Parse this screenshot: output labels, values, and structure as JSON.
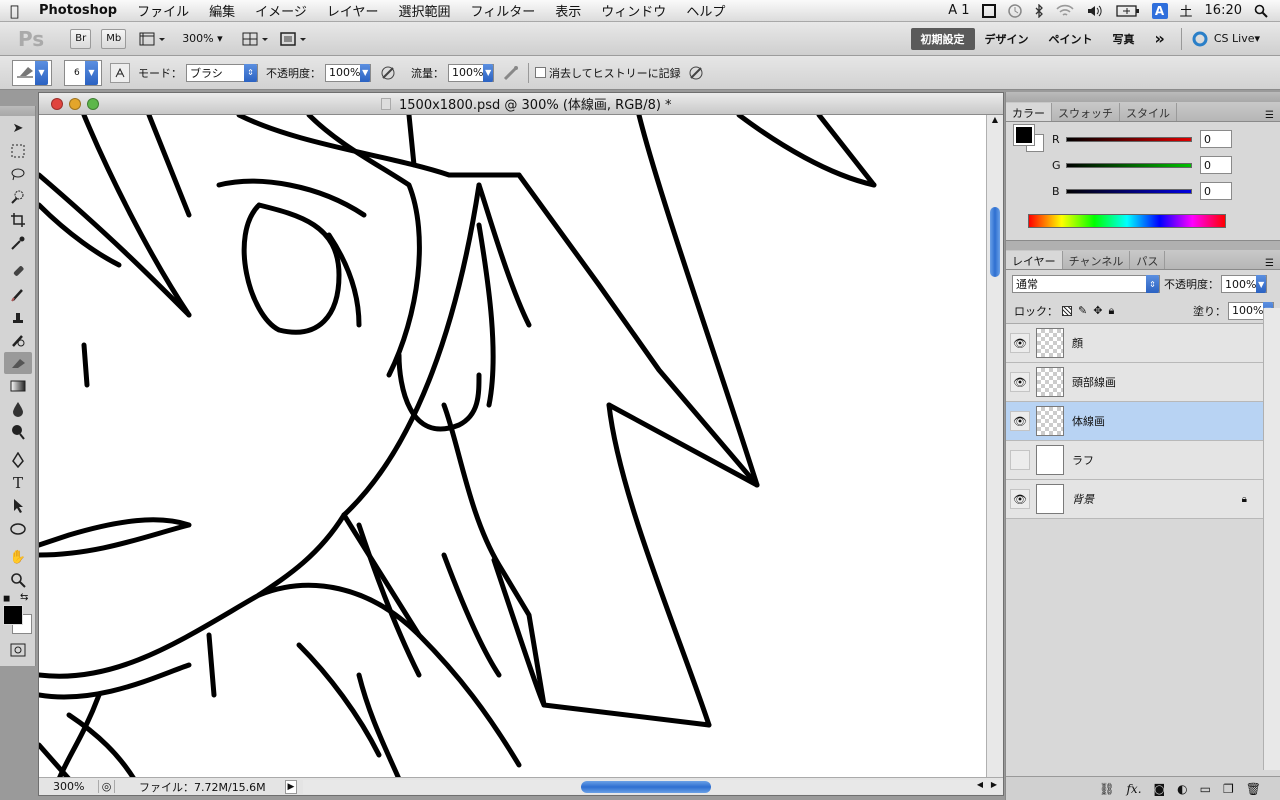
{
  "menubar": {
    "app_name": "Photoshop",
    "items": [
      "ファイル",
      "編集",
      "イメージ",
      "レイヤー",
      "選択範囲",
      "フィルター",
      "表示",
      "ウィンドウ",
      "ヘルプ"
    ],
    "status_items": {
      "input_indicator": "A 1",
      "date_label": "土",
      "time": "16:20"
    }
  },
  "appbar": {
    "logo": "Ps",
    "bridge_label": "Br",
    "mini_bridge_label": "Mb",
    "zoom": "300%",
    "workspaces": [
      "初期設定",
      "デザイン",
      "ペイント",
      "写真"
    ],
    "more_label": "»",
    "cs_live_label": "CS Live"
  },
  "options": {
    "brush_size": "6",
    "mode_label": "モード：",
    "mode_value": "ブラシ",
    "opacity_label": "不透明度：",
    "opacity_value": "100%",
    "flow_label": "流量：",
    "flow_value": "100%",
    "erase_history_label": "消去してヒストリーに記録"
  },
  "document": {
    "title": "1500x1800.psd @ 300% (体線画, RGB/8) *",
    "zoom_readout": "300%",
    "file_info": "ファイル：7.72M/15.6M"
  },
  "color_panel": {
    "tabs": [
      "カラー",
      "スウォッチ",
      "スタイル"
    ],
    "channels": [
      {
        "name": "R",
        "value": "0",
        "color": "#e00000"
      },
      {
        "name": "G",
        "value": "0",
        "color": "#00c000"
      },
      {
        "name": "B",
        "value": "0",
        "color": "#0000e0"
      }
    ],
    "foreground": "#000000",
    "background": "#ffffff"
  },
  "layers_panel": {
    "tabs": [
      "レイヤー",
      "チャンネル",
      "パス"
    ],
    "blend_mode": "通常",
    "opacity_label": "不透明度：",
    "opacity_value": "100%",
    "lock_label": "ロック：",
    "fill_label": "塗り：",
    "fill_value": "100%",
    "layers": [
      {
        "name": "顔",
        "visible": true,
        "selected": false,
        "locked": false
      },
      {
        "name": "頭部線画",
        "visible": true,
        "selected": false,
        "locked": false
      },
      {
        "name": "体線画",
        "visible": true,
        "selected": true,
        "locked": false
      },
      {
        "name": "ラフ",
        "visible": false,
        "selected": false,
        "locked": false
      },
      {
        "name": "背景",
        "visible": true,
        "selected": false,
        "locked": true
      }
    ],
    "footer_icons": [
      "link-icon",
      "fx-icon",
      "mask-icon",
      "adjustment-icon",
      "group-icon",
      "new-layer-icon",
      "trash-icon"
    ]
  }
}
